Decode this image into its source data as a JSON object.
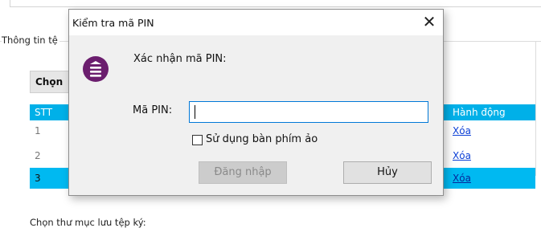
{
  "background": {
    "group_label": "Thông tin tệ",
    "choose_button": "Chọn",
    "table": {
      "headers": {
        "stt": "STT",
        "action": "Hành động"
      },
      "rows": [
        {
          "stt": "1",
          "action": "Xóa"
        },
        {
          "stt": "2",
          "action": "Xóa"
        },
        {
          "stt": "3",
          "action": "Xóa"
        }
      ],
      "selected_row": 3,
      "header_color": "#00b0e8",
      "selected_color": "#00b9f1"
    },
    "bottom_label": "Chọn thư mục lưu tệp ký:"
  },
  "dialog": {
    "title": "Kiểm tra mã PIN",
    "close_icon": "close-icon",
    "logo_icon": "app-logo-icon",
    "logo_color": "#6b1e6e",
    "confirm_text": "Xác nhận mã PIN:",
    "pin_label": "Mã PIN:",
    "pin_value": "",
    "checkbox_label": "Sử dụng bàn phím ảo",
    "checkbox_checked": false,
    "login_button": "Đăng nhập",
    "login_enabled": false,
    "cancel_button": "Hủy"
  }
}
